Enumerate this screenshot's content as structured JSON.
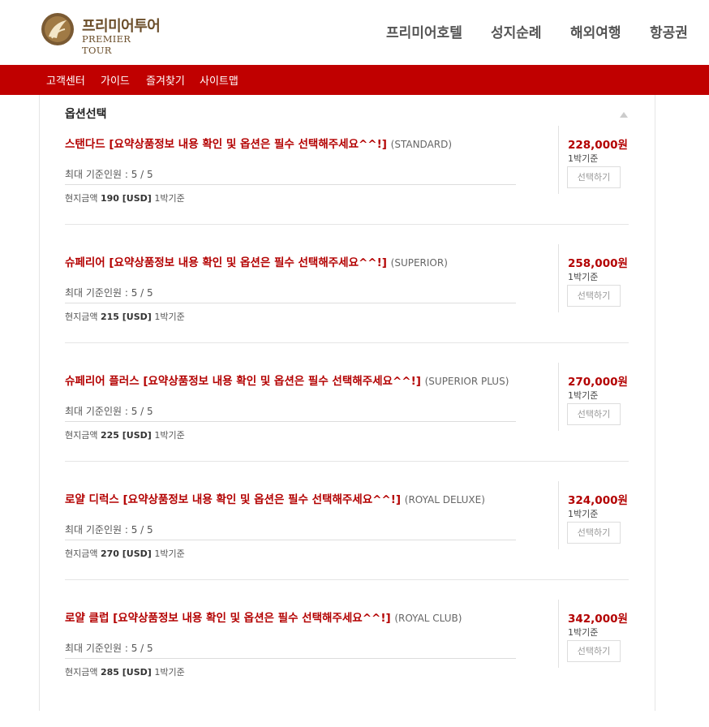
{
  "brand": {
    "name_ko": "프리미어투어",
    "name_en": "PREMIER TOUR"
  },
  "top_nav": [
    "프리미어호텔",
    "성지순례",
    "해외여행",
    "항공권"
  ],
  "sub_nav": [
    "고객센터",
    "가이드",
    "즐겨찾기",
    "사이트맵"
  ],
  "section": {
    "title": "옵션선택"
  },
  "options": [
    {
      "name": "스탠다드",
      "notice": "[요약상품정보 내용 확인 및 옵션은 필수 선택해주세요^^!]",
      "code": "(STANDARD)",
      "max_people": "최대 기준인원 : 5 / 5",
      "local_label": "현지금액",
      "local_amount": "190 [USD]",
      "local_unit": "1박기준",
      "price": "228,000원",
      "per": "1박기준",
      "button": "선택하기"
    },
    {
      "name": "슈페리어",
      "notice": "[요약상품정보 내용 확인 및 옵션은 필수 선택해주세요^^!]",
      "code": "(SUPERIOR)",
      "max_people": "최대 기준인원 : 5 / 5",
      "local_label": "현지금액",
      "local_amount": "215 [USD]",
      "local_unit": "1박기준",
      "price": "258,000원",
      "per": "1박기준",
      "button": "선택하기"
    },
    {
      "name": "슈페리어 플러스",
      "notice": "[요약상품정보 내용 확인 및 옵션은 필수 선택해주세요^^!]",
      "code": "(SUPERIOR PLUS)",
      "max_people": "최대 기준인원 : 5 / 5",
      "local_label": "현지금액",
      "local_amount": "225 [USD]",
      "local_unit": "1박기준",
      "price": "270,000원",
      "per": "1박기준",
      "button": "선택하기"
    },
    {
      "name": "로얄 디럭스",
      "notice": "[요약상품정보 내용 확인 및 옵션은 필수 선택해주세요^^!]",
      "code": "(ROYAL DELUXE)",
      "max_people": "최대 기준인원 : 5 / 5",
      "local_label": "현지금액",
      "local_amount": "270 [USD]",
      "local_unit": "1박기준",
      "price": "324,000원",
      "per": "1박기준",
      "button": "선택하기"
    },
    {
      "name": "로얄 클럽",
      "notice": "[요약상품정보 내용 확인 및 옵션은 필수 선택해주세요^^!]",
      "code": "(ROYAL CLUB)",
      "max_people": "최대 기준인원 : 5 / 5",
      "local_label": "현지금액",
      "local_amount": "285 [USD]",
      "local_unit": "1박기준",
      "price": "342,000원",
      "per": "1박기준",
      "button": "선택하기"
    }
  ],
  "colors": {
    "accent": "#c00000",
    "price": "#b30000",
    "brand_gold": "#6b4e2a"
  }
}
